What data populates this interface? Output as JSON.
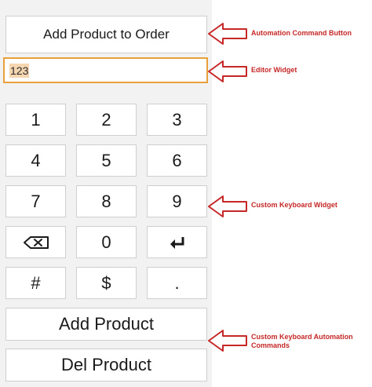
{
  "command_button": {
    "label": "Add Product to Order"
  },
  "editor": {
    "value": "123"
  },
  "keypad": {
    "keys": [
      "1",
      "2",
      "3",
      "4",
      "5",
      "6",
      "7",
      "8",
      "9",
      "⌫",
      "0",
      "↵",
      "#",
      "$",
      "."
    ]
  },
  "commands": {
    "add_label": "Add Product",
    "del_label": "Del Product"
  },
  "callouts": {
    "automation_button": "Automation Command Button",
    "editor_widget": "Editor Widget",
    "keyboard_widget": "Custom Keyboard Widget",
    "keyboard_commands": "Custom Keyboard Automation Commands"
  },
  "colors": {
    "accent": "#e8a13a",
    "callout": "#c62828"
  }
}
